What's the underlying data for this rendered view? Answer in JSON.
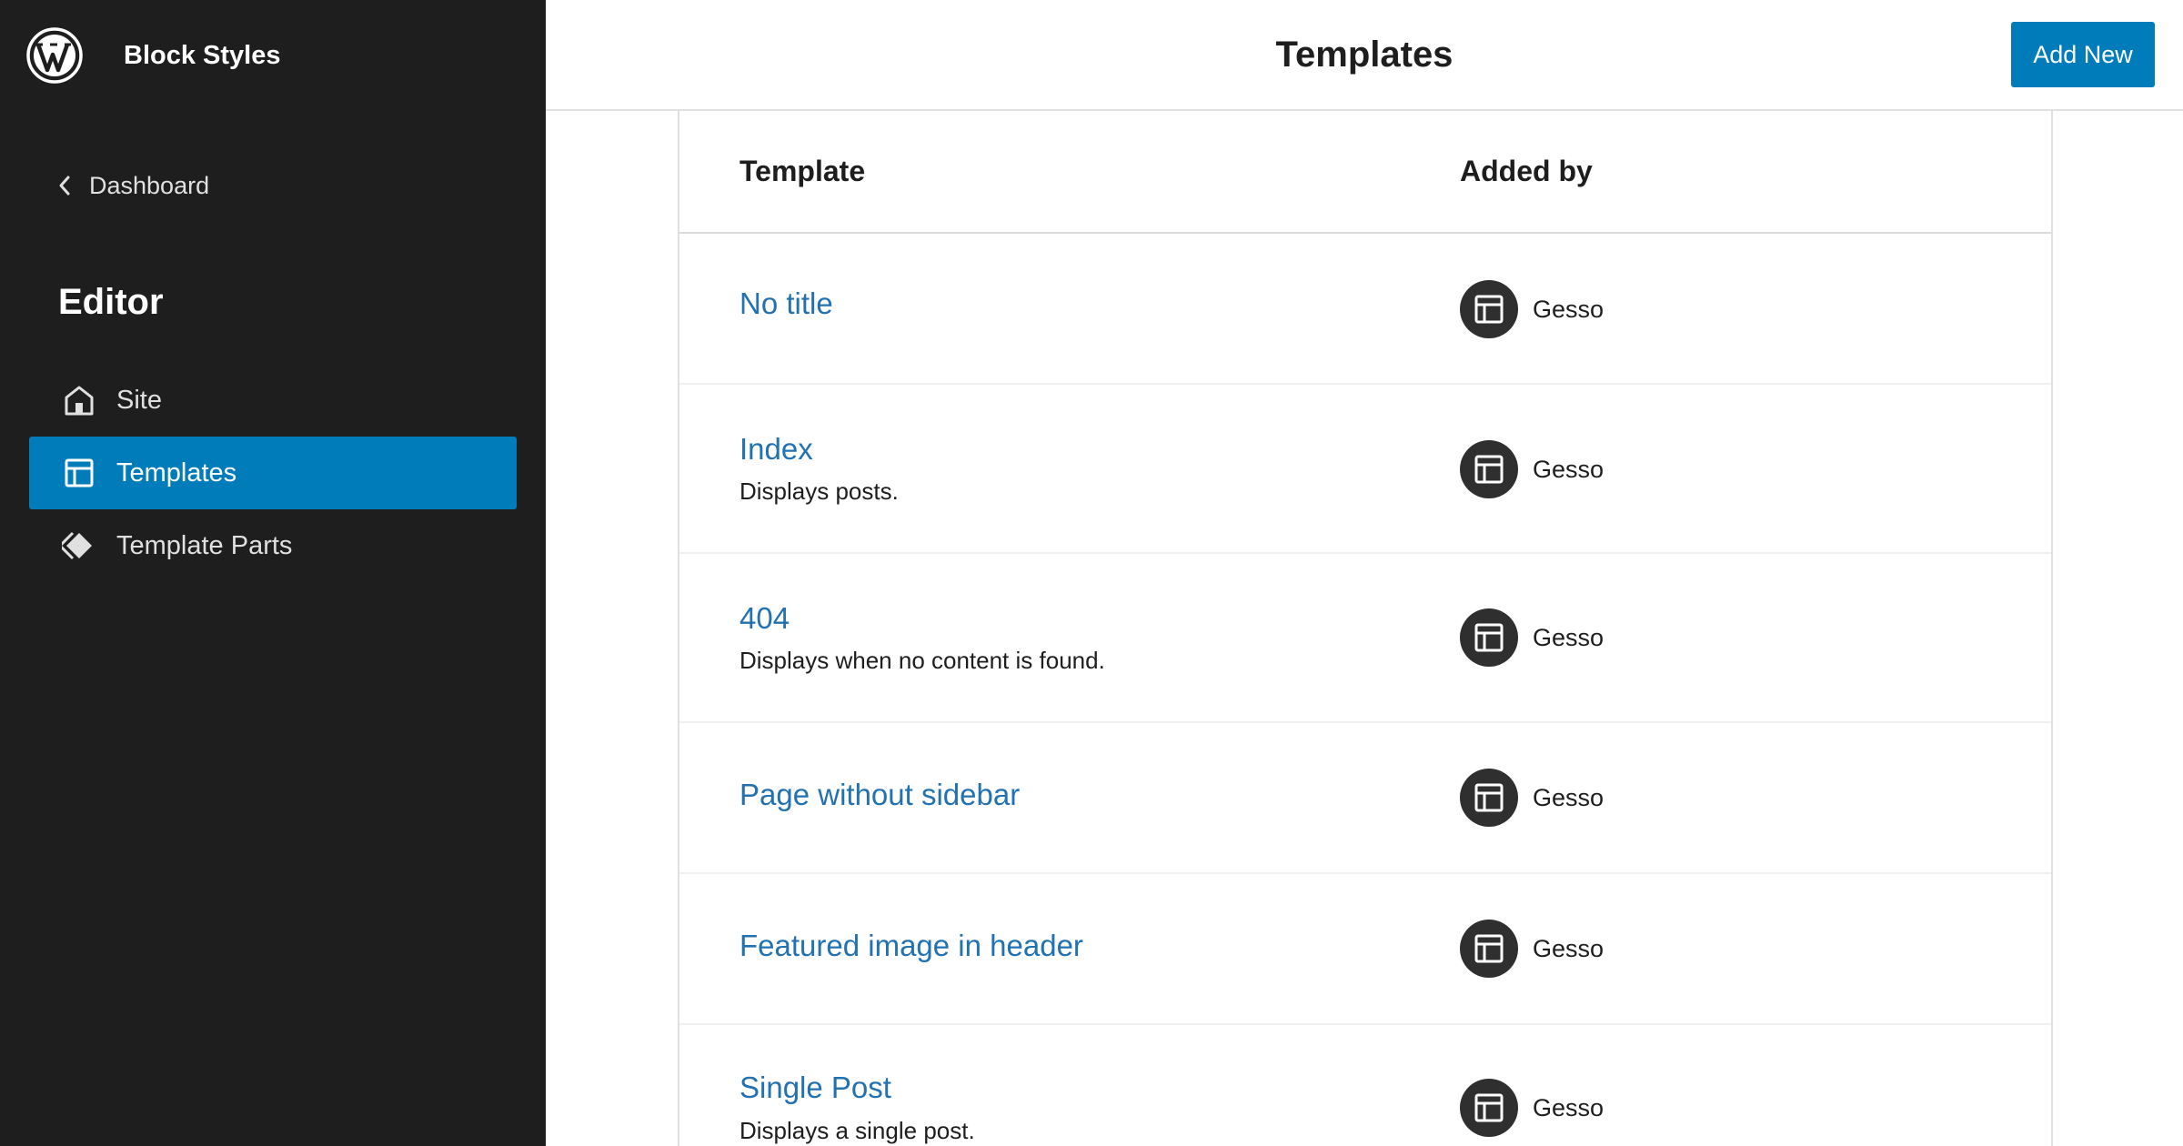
{
  "sidebar": {
    "site_title": "Block Styles",
    "back_label": "Dashboard",
    "heading": "Editor",
    "items": [
      {
        "label": "Site",
        "icon": "home-icon",
        "active": false
      },
      {
        "label": "Templates",
        "icon": "layout-icon",
        "active": true
      },
      {
        "label": "Template Parts",
        "icon": "symbol-filled-icon",
        "active": false
      }
    ]
  },
  "header": {
    "title": "Templates",
    "add_new_label": "Add New"
  },
  "table": {
    "columns": [
      "Template",
      "Added by"
    ],
    "rows": [
      {
        "title": "No title",
        "description": "",
        "author": "Gesso",
        "author_icon": "layout-icon"
      },
      {
        "title": "Index",
        "description": "Displays posts.",
        "author": "Gesso",
        "author_icon": "layout-icon"
      },
      {
        "title": "404",
        "description": "Displays when no content is found.",
        "author": "Gesso",
        "author_icon": "layout-icon"
      },
      {
        "title": "Page without sidebar",
        "description": "",
        "author": "Gesso",
        "author_icon": "layout-icon"
      },
      {
        "title": "Featured image in header",
        "description": "",
        "author": "Gesso",
        "author_icon": "layout-icon"
      },
      {
        "title": "Single Post",
        "description": "Displays a single post.",
        "author": "Gesso",
        "author_icon": "layout-icon"
      }
    ]
  },
  "colors": {
    "sidebar_bg": "#1e1e1e",
    "accent": "#007cba",
    "link": "#2271b1",
    "avatar_bg": "#2f2f2f"
  }
}
